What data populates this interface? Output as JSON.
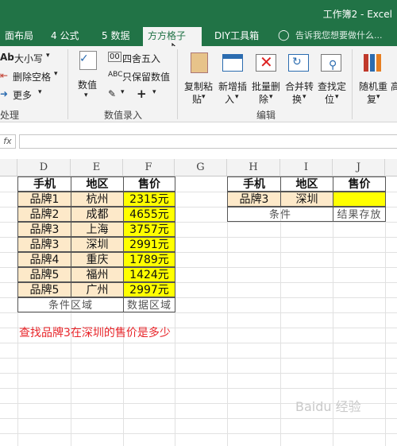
{
  "window": {
    "title": "工作簿2 - Excel"
  },
  "tabs": [
    {
      "label": "面布局",
      "active": false
    },
    {
      "label": "4 公式",
      "active": false
    },
    {
      "label": "5 数据",
      "active": false
    },
    {
      "label": "方方格子",
      "active": true
    },
    {
      "label": "DIY工具箱",
      "active": false
    },
    {
      "label": "告诉我您想要做什么...",
      "active": false
    }
  ],
  "ribbon": {
    "case_label": "大小写",
    "delete_space_label": "删除空格",
    "more_label": "更多",
    "processing_group": "处理",
    "numeric_label": "数值",
    "round_label": "四舍五入",
    "keep_values_label": "只保留数值",
    "data_entry_group": "数值录入",
    "copy_paste_label": "复制粘",
    "copy_paste_label2": "贴",
    "insert_label": "新增插",
    "insert_label2": "入",
    "batch_delete_label": "批量删",
    "batch_delete_label2": "除",
    "merge_label": "合并转",
    "merge_label2": "换",
    "find_label": "查找定",
    "find_label2": "位",
    "edit_group": "编辑",
    "random_label": "随机重",
    "random_label2": "复",
    "more_tools_label": "高"
  },
  "formula_bar": {
    "fx": "fx",
    "value": ""
  },
  "columns": [
    "D",
    "E",
    "F",
    "G",
    "H",
    "I",
    "J"
  ],
  "table1": {
    "headers": [
      "手机",
      "地区",
      "售价"
    ],
    "rows": [
      [
        "品牌1",
        "杭州",
        "2315元"
      ],
      [
        "品牌2",
        "成都",
        "4655元"
      ],
      [
        "品牌3",
        "上海",
        "3757元"
      ],
      [
        "品牌3",
        "深圳",
        "2991元"
      ],
      [
        "品牌4",
        "重庆",
        "1789元"
      ],
      [
        "品牌5",
        "福州",
        "1424元"
      ],
      [
        "品牌5",
        "广州",
        "2997元"
      ]
    ],
    "footer_condition": "条件区域",
    "footer_data": "数据区域"
  },
  "table2": {
    "headers": [
      "手机",
      "地区",
      "售价"
    ],
    "row": [
      "品牌3",
      "深圳",
      ""
    ],
    "footer_condition": "条件",
    "footer_result": "结果存放"
  },
  "question": "查找品牌3在深圳的售价是多少",
  "watermark": "Baidu 经验"
}
